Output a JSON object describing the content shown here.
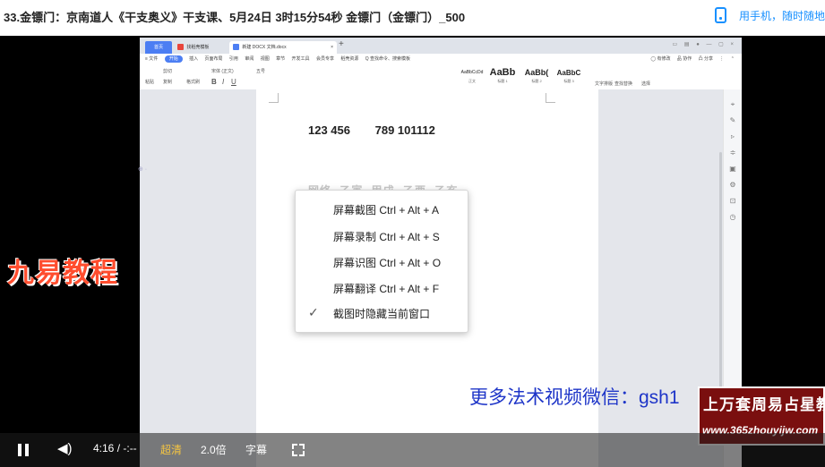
{
  "header": {
    "title": "33.金镖门：京南道人《干支奥义》干支课、5月24日 3时15分54秒 金镖门（金镖门）_500",
    "mobile_link": "用手机，随时随地看"
  },
  "wps": {
    "tabs": [
      {
        "label": "首页"
      },
      {
        "label": "找稻壳模板"
      },
      {
        "label": "新建 DOCX 文档.docx"
      }
    ],
    "tab_close": "×",
    "tab_add": "+",
    "window_controls": "▭ ▤ ● — ▢ ×",
    "menu_items": [
      "≡ 文件",
      "开始",
      "插入",
      "页面布局",
      "引用",
      "审阅",
      "视图",
      "章节",
      "开发工具",
      "会员专享",
      "稻壳资源",
      "Q 查找命令、搜索模板"
    ],
    "menu_right": [
      "◯ 有修改",
      "品 协作",
      "凸 分享",
      "⋮",
      "⌃"
    ],
    "ribbon_left": [
      "粘贴",
      "剪切",
      "复制",
      "格式刷",
      "宋体 (正文)",
      "五号",
      "B",
      "I",
      "U"
    ],
    "style_samples": [
      {
        "sample": "AaBbCcDd",
        "name": "正文"
      },
      {
        "sample": "AaBb",
        "name": "标题 1"
      },
      {
        "sample": "AaBb(",
        "name": "标题 2"
      },
      {
        "sample": "AaBbC",
        "name": "标题 3"
      }
    ],
    "ribbon_right": [
      "文字排版",
      "查找替换",
      "选择"
    ]
  },
  "document": {
    "numbers": [
      "123 456",
      "789 101112"
    ],
    "faded_line": "网络 ·乙寅 ·甲戌 ·乙酉 ·乙亥",
    "para_mark": "⊕ ·"
  },
  "context_menu": {
    "items": [
      {
        "label": "屏幕截图 Ctrl + Alt + A"
      },
      {
        "label": "屏幕录制 Ctrl + Alt + S"
      },
      {
        "label": "屏幕识图 Ctrl + Alt + O"
      },
      {
        "label": "屏幕翻译 Ctrl + Alt + F"
      },
      {
        "label": "截图时隐藏当前窗口",
        "checked": true
      }
    ],
    "check_mark": "✓"
  },
  "watermarks": {
    "left": "九易教程",
    "bottom": "更多法术视频微信：gsh1",
    "stamp_line1": "上万套周易占星教程",
    "stamp_line2": "www.365zhouyijw.com"
  },
  "player": {
    "time": "4:16 / -:--",
    "quality": "超清",
    "speed": "2.0倍",
    "subtitle": "字幕"
  },
  "colors": {
    "accent": "#1890ff",
    "wps_blue": "#4c7ef3",
    "watermark_red": "#ff4d2e",
    "watermark_blue": "#1e35c8",
    "quality_yellow": "#f5c542"
  }
}
